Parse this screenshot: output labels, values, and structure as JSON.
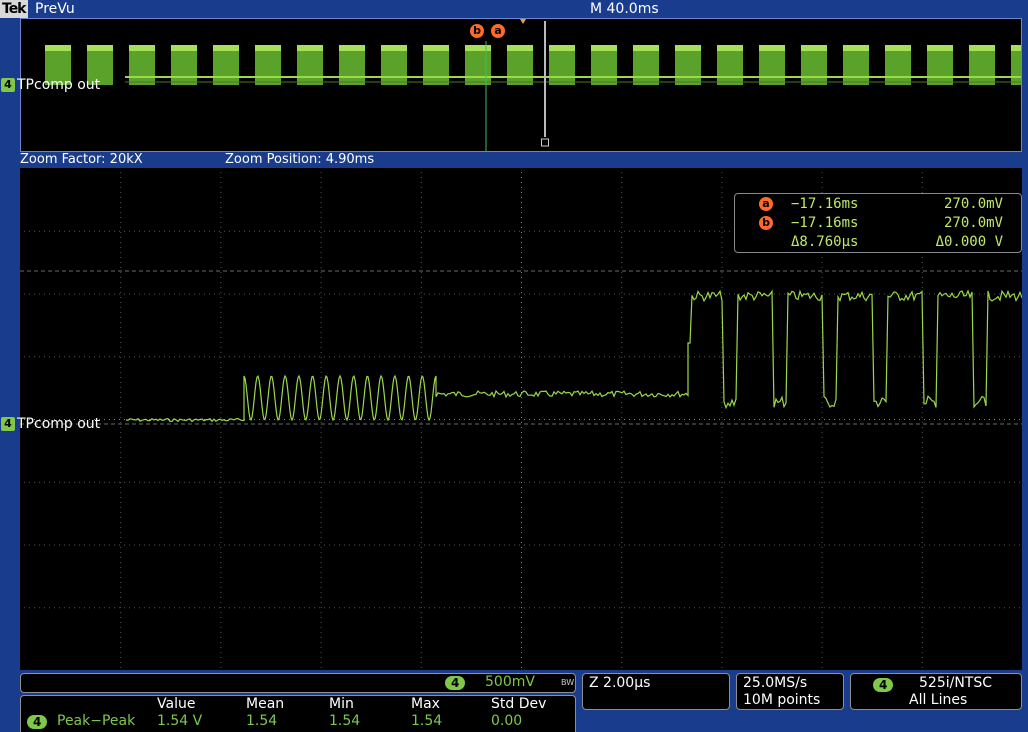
{
  "header": {
    "brand": "Tek",
    "state": "PreVu",
    "horizontal": "M 40.0ms"
  },
  "overview": {
    "channel_badge": "4",
    "channel_label": "TPcomp out",
    "cursor_marks": [
      "b",
      "a"
    ],
    "cursor_b_pos": 0.465,
    "cursor_a_pos": 0.468,
    "zoom_window_pos": 0.524
  },
  "zoom": {
    "factor": "Zoom Factor: 20kX",
    "position": "Zoom Position: 4.90ms"
  },
  "main": {
    "channel_badge": "4",
    "channel_label": "TPcomp out"
  },
  "cursors": {
    "a": {
      "badge": "a",
      "time": "−17.16ms",
      "value": "270.0mV"
    },
    "b": {
      "badge": "b",
      "time": "−17.16ms",
      "value": "270.0mV"
    },
    "delta": {
      "time": "Δ8.760µs",
      "value": "Δ0.000 V"
    }
  },
  "bottom": {
    "channel": {
      "badge": "4",
      "scale": "500mV",
      "bw": "BW"
    },
    "measurement": {
      "headers": [
        "Value",
        "Mean",
        "Min",
        "Max",
        "Std Dev"
      ],
      "badge": "4",
      "name": "Peak−Peak",
      "values": [
        "1.54 V",
        "1.54",
        "1.54",
        "1.54",
        "0.00"
      ]
    },
    "zoom_scale": "Z 2.00µs",
    "acquisition": {
      "rate": "25.0MS/s",
      "points": "10M points"
    },
    "trigger": {
      "badge": "4",
      "standard": "525i/NTSC",
      "lines": "All Lines"
    }
  },
  "colors": {
    "trace": "#9bd84a",
    "frame": "#1a3c8c",
    "cursor": "#ff6a2a",
    "grid": "#5a5a5a"
  }
}
